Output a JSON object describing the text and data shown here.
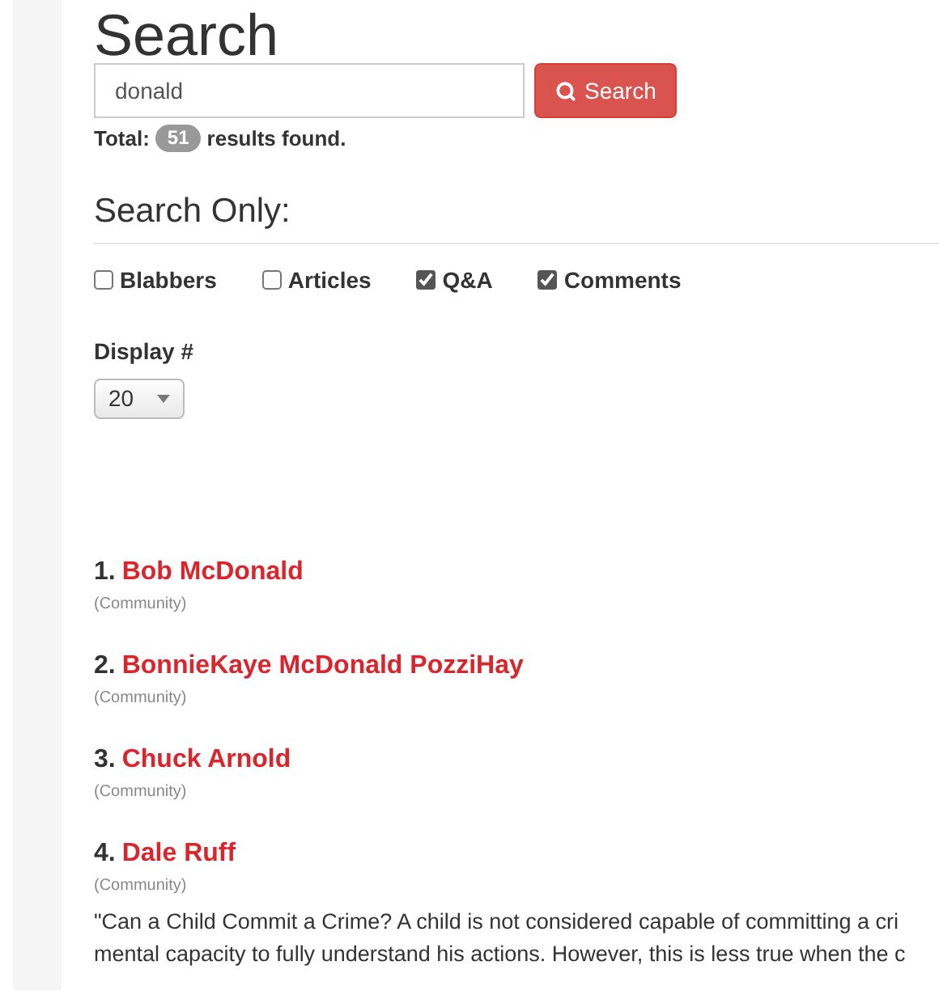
{
  "title": "Search",
  "search": {
    "value": "donald",
    "button": "Search"
  },
  "total": {
    "label": "Total:",
    "count": "51",
    "suffix": "results found."
  },
  "filter_heading": "Search Only:",
  "filters": [
    {
      "label": "Blabbers",
      "checked": false
    },
    {
      "label": "Articles",
      "checked": false
    },
    {
      "label": "Q&A",
      "checked": true
    },
    {
      "label": "Comments",
      "checked": true
    }
  ],
  "display": {
    "label": "Display #",
    "value": "20"
  },
  "results": [
    {
      "number": "1.",
      "name": "Bob McDonald",
      "category": "(Community)"
    },
    {
      "number": "2.",
      "name": "BonnieKaye McDonald PozziHay",
      "category": "(Community)"
    },
    {
      "number": "3.",
      "name": "Chuck Arnold",
      "category": "(Community)"
    },
    {
      "number": "4.",
      "name": "Dale Ruff",
      "category": "(Community)",
      "snippet_lines": [
        "\"Can a Child Commit a Crime? A child is not considered capable of committing a cri",
        "mental capacity to fully understand his actions. However, this is less true when the c"
      ]
    }
  ]
}
